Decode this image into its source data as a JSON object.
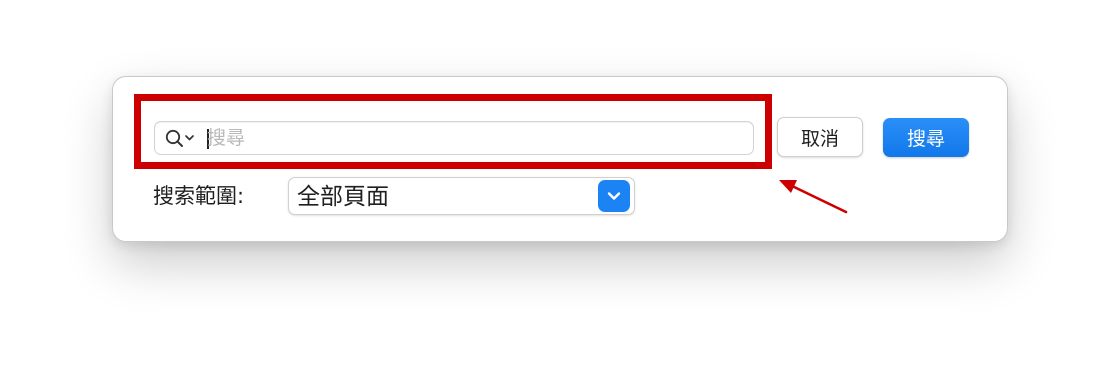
{
  "search": {
    "placeholder": "搜尋",
    "value": ""
  },
  "buttons": {
    "cancel_label": "取消",
    "search_label": "搜尋"
  },
  "scope": {
    "label": "搜索範圍:",
    "selected": "全部頁面"
  },
  "colors": {
    "accent": "#1b83f4",
    "highlight": "#cc0000"
  },
  "icons": {
    "search_menu": "magnifier-with-chevron",
    "select": "chevron-down",
    "annotation": "arrow"
  }
}
